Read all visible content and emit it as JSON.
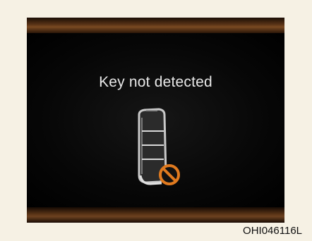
{
  "display": {
    "message": "Key not detected",
    "icons": {
      "key": "smart-key-fob-icon",
      "prohibited": "prohibited-icon"
    },
    "colors": {
      "background": "#000000",
      "text": "#e8e8e8",
      "accent_bar": "#6d4220",
      "prohibited": "#e07a1f"
    }
  },
  "figure_code": "OHI046116L"
}
